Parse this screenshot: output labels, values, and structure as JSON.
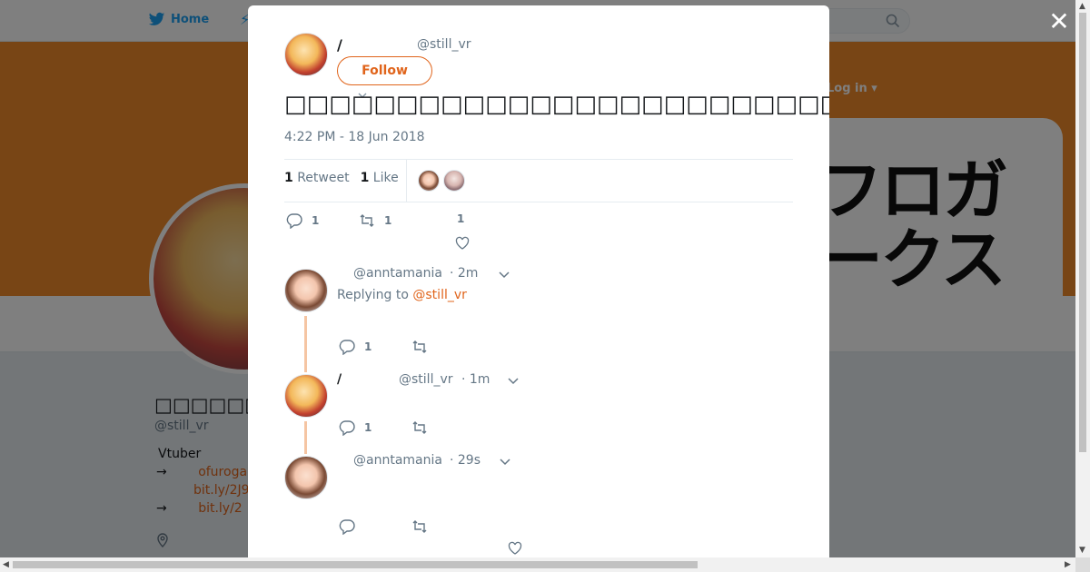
{
  "background": {
    "nav": {
      "home_label": "Home",
      "login_label": "Log in"
    },
    "banner": {
      "text_line1": "フロガ",
      "text_line2": "ークス"
    },
    "profile": {
      "name": "□□□□□□/□□",
      "handle": "@still_vr",
      "bio_line1": "Vtuber",
      "bio_line2_arrow": "→",
      "bio_line2_link": "ofuroga",
      "bio_line3_link": "bit.ly/2J9",
      "bio_line4_arrow": "→",
      "bio_line4_link": "bit.ly/2"
    }
  },
  "modal": {
    "author": {
      "name": "/",
      "handle": "@still_vr"
    },
    "follow_label": "Follow",
    "tweet_text": "□□□□□□□□□□□□□□□□□□□□□□□□□□□□□□□□□□□□□□□□□□H□□□□□□□□□□□□□□□□□□□□□□□□□□□",
    "timestamp": "4:22 PM - 18 Jun 2018",
    "stats": {
      "retweets_count": "1",
      "retweets_label": "Retweet",
      "likes_count": "1",
      "likes_label": "Like"
    },
    "actions": {
      "reply_count": "1",
      "retweet_count": "1",
      "like_count": "1"
    },
    "replies": [
      {
        "handle": "@anntamania",
        "time": "· 2m",
        "replying_prefix": "Replying to",
        "replying_to": "@still_vr",
        "reply_count": "1"
      },
      {
        "name": "/",
        "handle": "@still_vr",
        "time": "· 1m",
        "reply_count": "1"
      },
      {
        "handle": "@anntamania",
        "time": "· 29s"
      }
    ]
  },
  "colors": {
    "accent": "#e0641b",
    "banner": "#f08a2b",
    "twitter_blue": "#1da1f2"
  },
  "icons": [
    "twitter-bird-icon",
    "search-icon",
    "close-icon",
    "reply-icon",
    "retweet-icon",
    "heart-icon",
    "chevron-down-icon",
    "location-icon"
  ]
}
